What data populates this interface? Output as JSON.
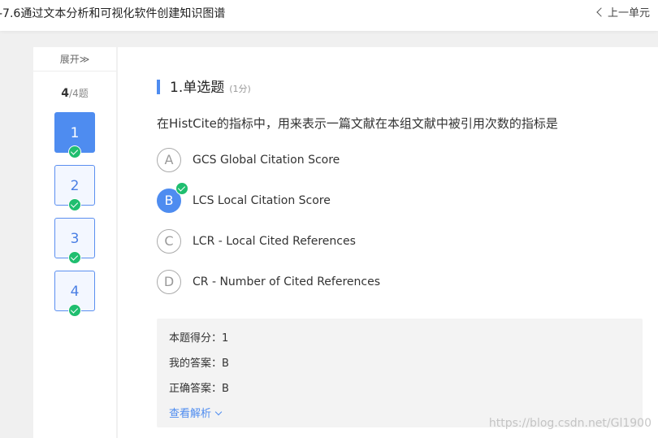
{
  "header": {
    "title": "-7.6通过文本分析和可视化软件创建知识图谱",
    "prev_label": "上一单元"
  },
  "sidebar": {
    "expand_label": "展开≫",
    "current": "4",
    "total": "/4题",
    "questions": [
      "1",
      "2",
      "3",
      "4"
    ]
  },
  "question": {
    "title": "1.单选题",
    "score": "(1分)",
    "stem": "在HistCite的指标中，用来表示一篇文献在本组文献中被引用次数的指标是",
    "options": [
      {
        "letter": "A",
        "text": "GCS Global Citation Score"
      },
      {
        "letter": "B",
        "text": "LCS Local Citation Score"
      },
      {
        "letter": "C",
        "text": "LCR - Local Cited References"
      },
      {
        "letter": "D",
        "text": "CR - Number of Cited References"
      }
    ],
    "selected": "B"
  },
  "result": {
    "score_label": "本题得分：1",
    "my_answer_label": "我的答案：B",
    "correct_answer_label": "正确答案：B",
    "analysis_label": "查看解析"
  },
  "watermark": "https://blog.csdn.net/Gl1900",
  "colors": {
    "accent": "#4e8cf0",
    "correct": "#1fbe6f",
    "background": "#f0f0f0"
  }
}
